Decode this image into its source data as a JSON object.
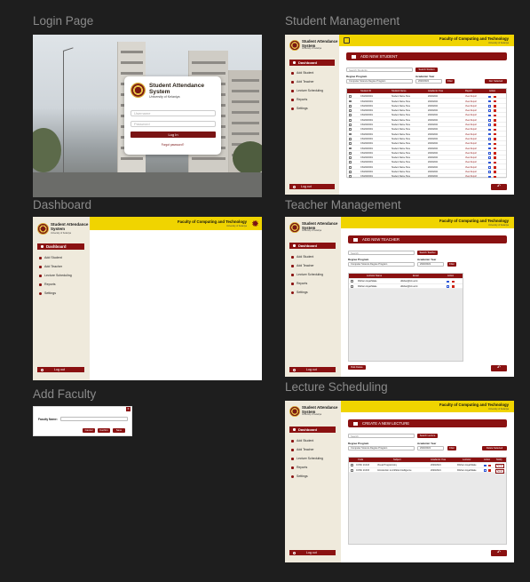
{
  "frames": {
    "login": {
      "label": "Login Page"
    },
    "student": {
      "label": "Student Management"
    },
    "dashboard": {
      "label": "Dashboard"
    },
    "teacher": {
      "label": "Teacher Management"
    },
    "faculty": {
      "label": "Add Faculty"
    },
    "lecture": {
      "label": "Lecture Scheduling"
    }
  },
  "brand": {
    "line1": "Student Attendance",
    "line2": "System",
    "university": "University of Kelaniya"
  },
  "header": {
    "faculty": "Faculty of Computing and Technology",
    "subtitle": "University of Kelaniya"
  },
  "nav": {
    "dashboard": "Dashboard",
    "add_student": "Add Student",
    "add_teacher": "Add Teacher",
    "lecture_scheduling": "Lecture Scheduling",
    "reports": "Reports",
    "settings": "Settings",
    "logout": "Log out",
    "logout_alt": "Log out"
  },
  "login": {
    "username_placeholder": "Username",
    "password_placeholder": "Password",
    "login_button": "Log In",
    "forgot": "Forgot password?"
  },
  "student": {
    "banner": "ADD NEW STUDENT",
    "search_placeholder": "Search Students",
    "search_button": "Search Student",
    "degree_label": "Degree Program",
    "degree_value": "Computer Science Degree Program",
    "year_label": "Academic Year",
    "year_value": "2020/2021",
    "filter_button": "Filter",
    "delete_button": "Del. Selected",
    "columns": [
      "Student ID",
      "Student Name",
      "Academic Year",
      "Report",
      "Action"
    ],
    "row": {
      "id": "CS/2020/001",
      "name": "Student Name Here",
      "year": "2020/2021",
      "report": "View Report"
    }
  },
  "teacher": {
    "banner": "ADD NEW TEACHER",
    "search_placeholder": "Search",
    "search_button": "Search Teacher",
    "degree_label": "Degree Program",
    "degree_value": "Computer Science Degree Program",
    "year_label": "Academic Year",
    "year_value": "2020/2021",
    "filter_button": "Filter",
    "delete_button": "Bulk Delete",
    "columns": [
      "Lecturer Name",
      "Email",
      "Action"
    ],
    "rows": [
      {
        "name": "Dilshan Jayathilake",
        "email": "dilshan@kln.ac.lk"
      },
      {
        "name": "Dilshan Jayathilake",
        "email": "dilshan@kln.ac.lk"
      }
    ]
  },
  "faculty": {
    "label": "Faculty Name:",
    "cancel": "Cancel",
    "confirm": "Confirm",
    "save": "Save",
    "close": "x"
  },
  "lecture": {
    "banner": "CREATE A NEW LECTURE",
    "search_placeholder": "Search",
    "search_button": "Search Lecture",
    "degree_label": "Degree Program",
    "degree_value": "Computer Science Degree Program",
    "year_label": "Academic Year",
    "year_value": "2020/2021",
    "filter_button": "Filter",
    "delete_button": "Delete Selected",
    "columns": [
      "Code",
      "Subject",
      "Academic Year",
      "Lecturer",
      "Action",
      "Notify"
    ],
    "rows": [
      {
        "code": "COSC 21043",
        "subject": "Visual Programming",
        "year": "2020/2021",
        "lecturer": "Dilshan Jayathilake",
        "notify": "Send"
      },
      {
        "code": "COSC 21033",
        "subject": "Introduction to Artificial Intelligence",
        "year": "2020/2021",
        "lecturer": "Dilshan Jayathilake",
        "notify": "Send"
      }
    ]
  },
  "colors": {
    "maroon": "#8a1111",
    "yellow": "#f0d400",
    "sidebar": "#efeadc",
    "canvas": "#1e1e1e"
  }
}
